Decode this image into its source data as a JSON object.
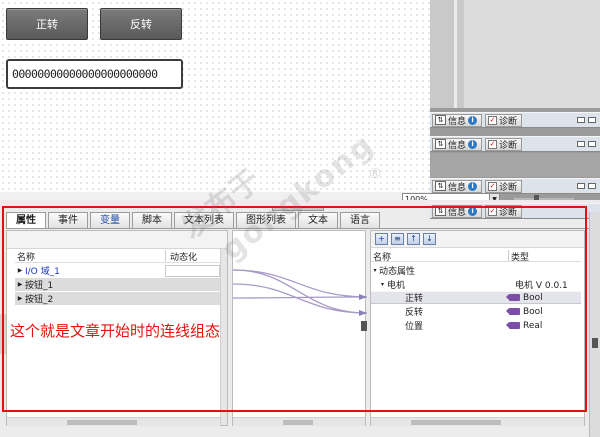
{
  "hmi_screen": {
    "forward_button": "正转",
    "reverse_button": "反转",
    "io_field_value": "00000000000000000000000"
  },
  "info_bars": [
    {
      "info": "信息",
      "diag": "诊断"
    },
    {
      "info": "信息",
      "diag": "诊断"
    },
    {
      "info": "信息",
      "diag": "诊断"
    },
    {
      "info": "信息",
      "diag": "诊断"
    }
  ],
  "zoom": "100%",
  "tabs": [
    "属性",
    "事件",
    "变量",
    "脚本",
    "文本列表",
    "图形列表",
    "文本",
    "语言"
  ],
  "left_pane": {
    "col_name": "名称",
    "col_dynamic": "动态化",
    "rows": [
      "I/O 域_1",
      "按钮_1",
      "按钮_2"
    ]
  },
  "right_pane": {
    "col_name": "名称",
    "col_type": "类型",
    "group": "动态属性",
    "motor": "电机",
    "motor_type": "电机 V 0.0.1",
    "props": [
      {
        "name": "正转",
        "type": "Bool"
      },
      {
        "name": "反转",
        "type": "Bool"
      },
      {
        "name": "位置",
        "type": "Real"
      }
    ]
  },
  "annotation": "这个就是文章开始时的连线组态",
  "watermark": {
    "line1": "发布于",
    "line2": "gongkong",
    "mark": "®"
  }
}
